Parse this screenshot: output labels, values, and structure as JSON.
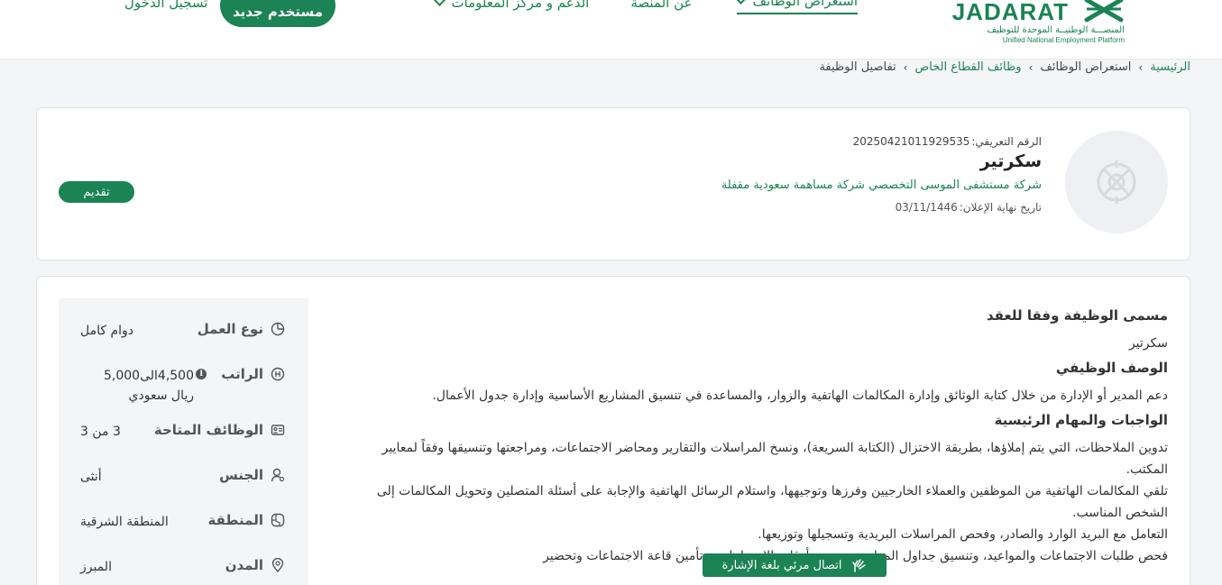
{
  "header": {
    "logo": {
      "en": "JADARAT",
      "ar": "المنصـــة الوطنيــة الموحدة للتوظيف",
      "sub": "Unified National Employment Platform"
    },
    "nav": [
      {
        "label": "استعراض الوظائف"
      },
      {
        "label": "عن المنصة"
      },
      {
        "label": "الدعم و مركز المعلومات"
      }
    ],
    "register_label": "مستخدم جديد",
    "login_label": "تسجيل الدخول"
  },
  "breadcrumb": {
    "home": "الرئيسية",
    "browse": "استعراض الوظائف",
    "private": "وظائف القطاع الخاص",
    "current": "تفاصيل الوظيفة"
  },
  "job": {
    "id_label": "الرقم التعريفي:",
    "id_value": "20250421011929535",
    "title": "سكرتير",
    "company": "شركة مستشفى الموسى التخصصي شركة مساهمة سعودية مقفلة",
    "deadline_label": "تاريخ نهاية الإعلان:",
    "deadline_value": "03/11/1446",
    "apply_label": "تقديم"
  },
  "details": [
    {
      "label": "نوع العمل",
      "value": "دوام كامل",
      "icon": "clock-icon"
    },
    {
      "label": "الراتب",
      "value": "4,500الى5,000 ريال سعودي",
      "icon": "salary-icon"
    },
    {
      "label": "الوظائف المتاحة",
      "value": "3 من 3",
      "icon": "id-card-icon"
    },
    {
      "label": "الجنس",
      "value": "أنثى",
      "icon": "gender-icon"
    },
    {
      "label": "المنطقة",
      "value": "المنطقة الشرقية",
      "icon": "map-icon"
    },
    {
      "label": "المدن",
      "value": "المبرز",
      "icon": "location-pin-icon"
    }
  ],
  "description": {
    "title_heading": "مسمى الوظيفة وفقا للعقد",
    "title_value": "سكرتير",
    "desc_heading": "الوصف الوظيفي",
    "desc_value": "دعم المدير أو الإدارة من خلال كتابة الوثائق وإدارة المكالمات الهاتفية والزوار، والمساعدة في تنسيق المشاريع الأساسية وإدارة جدول الأعمال.",
    "duties_heading": "الواجبات والمهام الرئيسية",
    "duties": [
      "تدوين الملاحظات، التي يتم إملاؤها، بطريقة الاختزال (الكتابة السريعة)، ونسخ المراسلات والتقارير ومحاضر الاجتماعات، ومراجعتها وتنسيقها وفقاً لمعايير المكتب.",
      "تلقي المكالمات الهاتفية من الموظفين والعملاء الخارجيين وفرزها وتوجيهها، واستلام الرسائل الهاتفية والإجابة على أسئلة المتصلين وتحويل المكالمات إلى الشخص المناسب.",
      "التعامل مع البريد الوارد والصادر، وفحص المراسلات البريدية وتسجيلها وتوزيعها.",
      "فحص طلبات الاجتماعات والمواعيد، وتنسيق جداول المواعيد، وتحديد أوقات الاجتماعات، وتأمين قاعة الاجتماعات وتحضير"
    ]
  },
  "sign_language_label": "اتصال مرئي بلغة الإشارة"
}
